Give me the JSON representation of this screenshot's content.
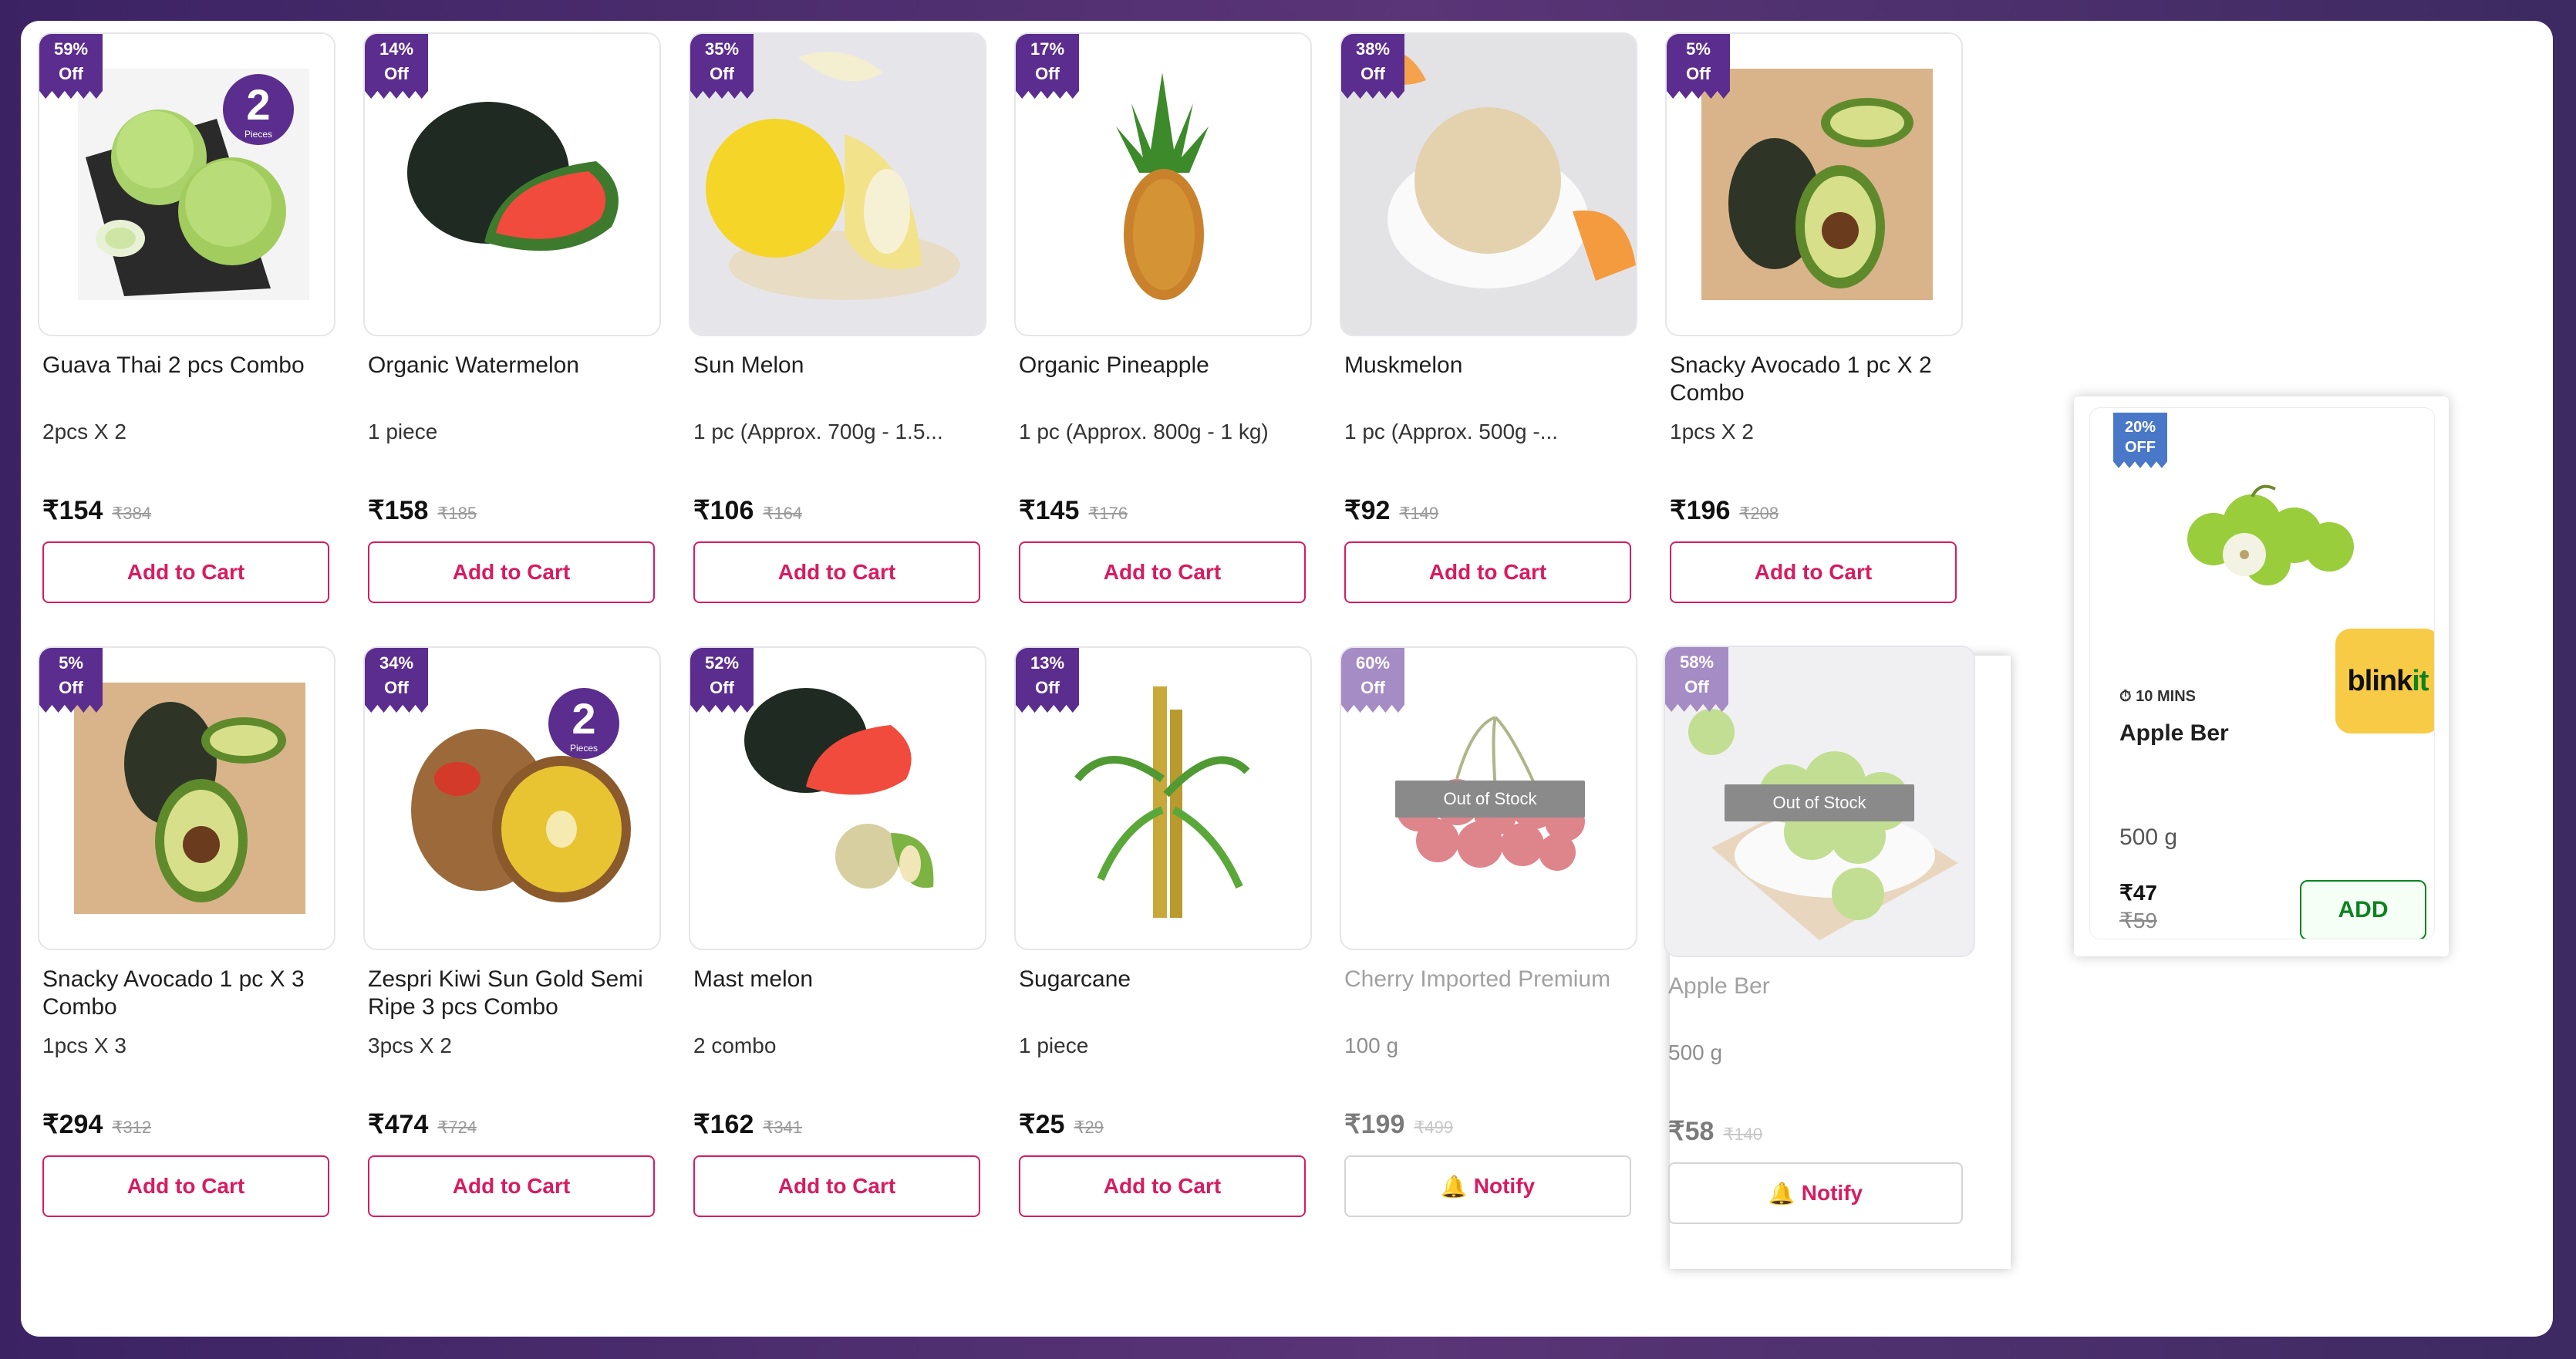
{
  "products_row1": [
    {
      "discount": "59%",
      "off": "Off",
      "name": "Guava Thai 2 pcs Combo",
      "qty": "2pcs X 2",
      "price": "₹154",
      "mrp": "₹384",
      "action": "Add to Cart",
      "image": "guava-image",
      "pieces_badge": "2",
      "pieces_label": "Pieces"
    },
    {
      "discount": "14%",
      "off": "Off",
      "name": "Organic Watermelon",
      "qty": "1 piece",
      "price": "₹158",
      "mrp": "₹185",
      "action": "Add to Cart",
      "image": "watermelon-image"
    },
    {
      "discount": "35%",
      "off": "Off",
      "name": "Sun Melon",
      "qty": "1 pc (Approx. 700g - 1.5...",
      "price": "₹106",
      "mrp": "₹164",
      "action": "Add to Cart",
      "image": "sun-melon-image"
    },
    {
      "discount": "17%",
      "off": "Off",
      "name": "Organic Pineapple",
      "qty": "1 pc (Approx. 800g - 1 kg)",
      "price": "₹145",
      "mrp": "₹176",
      "action": "Add to Cart",
      "image": "pineapple-image"
    },
    {
      "discount": "38%",
      "off": "Off",
      "name": "Muskmelon",
      "qty": "1 pc (Approx. 500g -...",
      "price": "₹92",
      "mrp": "₹149",
      "action": "Add to Cart",
      "image": "muskmelon-image"
    },
    {
      "discount": "5%",
      "off": "Off",
      "name": "Snacky Avocado 1 pc X 2 Combo",
      "qty": "1pcs X 2",
      "price": "₹196",
      "mrp": "₹208",
      "action": "Add to Cart",
      "image": "avocado-image"
    }
  ],
  "products_row2": [
    {
      "discount": "5%",
      "off": "Off",
      "name": "Snacky Avocado 1 pc X 3 Combo",
      "qty": "1pcs X 3",
      "price": "₹294",
      "mrp": "₹312",
      "action": "Add to Cart",
      "image": "avocado-image"
    },
    {
      "discount": "34%",
      "off": "Off",
      "name": "Zespri Kiwi Sun Gold Semi Ripe 3 pcs Combo",
      "qty": "3pcs X 2",
      "price": "₹474",
      "mrp": "₹724",
      "action": "Add to Cart",
      "image": "kiwi-image",
      "pieces_badge": "2",
      "pieces_label": "Pieces"
    },
    {
      "discount": "52%",
      "off": "Off",
      "name": "Mast melon",
      "qty": "2 combo",
      "price": "₹162",
      "mrp": "₹341",
      "action": "Add to Cart",
      "image": "mast-melon-image"
    },
    {
      "discount": "13%",
      "off": "Off",
      "name": "Sugarcane",
      "qty": "1 piece",
      "price": "₹25",
      "mrp": "₹29",
      "action": "Add to Cart",
      "image": "sugarcane-image"
    },
    {
      "discount": "60%",
      "off": "Off",
      "name": "Cherry Imported Premium",
      "qty": "100 g",
      "price": "₹199",
      "mrp": "₹499",
      "action": "Notify",
      "out_of_stock": "Out of Stock",
      "image": "cherry-image"
    },
    {
      "discount": "58%",
      "off": "Off",
      "name": "Apple Ber",
      "qty": "500 g",
      "price": "₹58",
      "mrp": "₹140",
      "action": "Notify",
      "out_of_stock": "Out of Stock",
      "image": "apple-ber-image"
    }
  ],
  "blinkit": {
    "discount": "20%",
    "off": "OFF",
    "logo_a": "blink",
    "logo_b": "it",
    "delivery": "10 MINS",
    "name": "Apple Ber",
    "qty": "500 g",
    "price": "₹47",
    "mrp": "₹59",
    "action": "ADD"
  },
  "colors": {
    "accent": "#d81b60",
    "badge": "#5b2d8e",
    "blinkit_green": "#0c831f",
    "blinkit_yellow": "#f8cb46"
  }
}
